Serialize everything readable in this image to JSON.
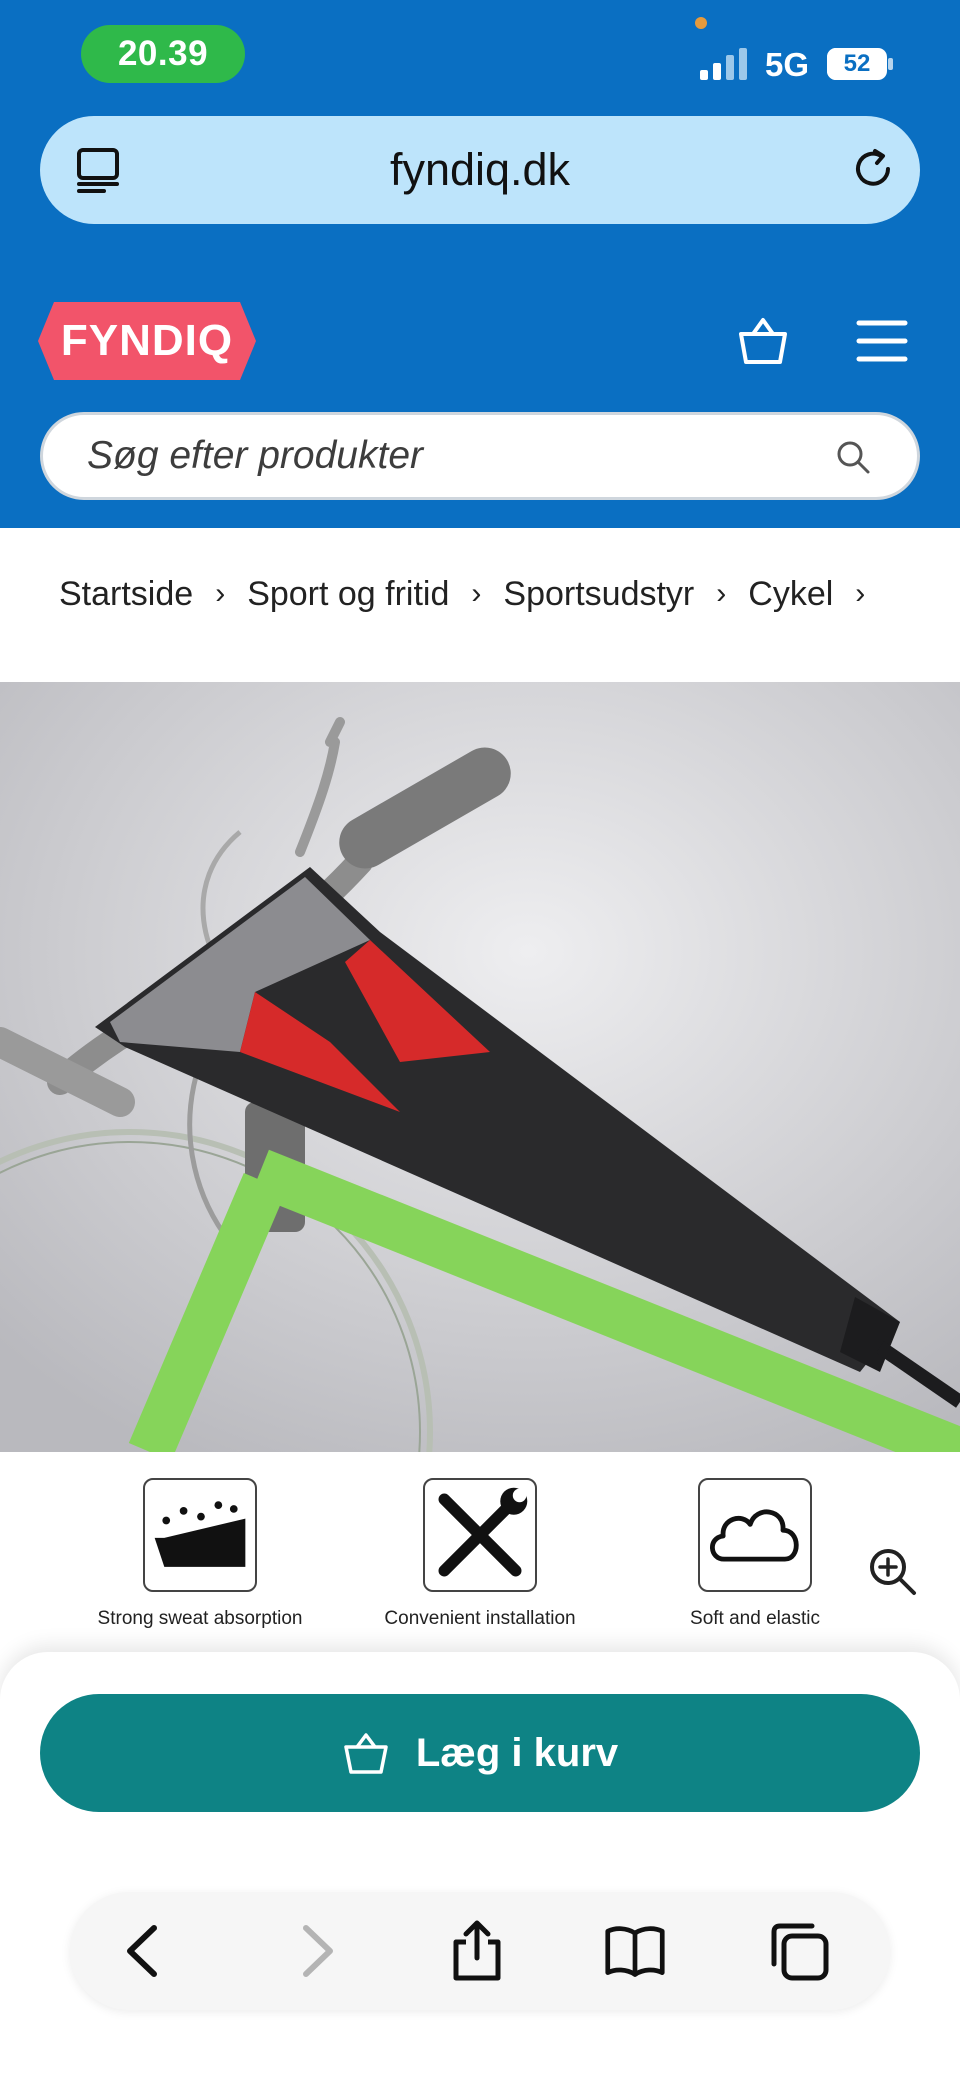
{
  "status_bar": {
    "time": "20.39",
    "network": "5G",
    "battery": "52"
  },
  "browser": {
    "url": "fyndiq.dk"
  },
  "site": {
    "logo": "FYNDIQ",
    "search_placeholder": "Søg efter produkter"
  },
  "breadcrumb": [
    "Startside",
    "Sport og fritid",
    "Sportsudstyr",
    "Cykel"
  ],
  "product": {
    "features": [
      "Strong sweat absorption",
      "Convenient installation",
      "Soft and elastic"
    ]
  },
  "actions": {
    "add_to_cart": "Læg i kurv"
  },
  "colors": {
    "header_blue": "#0a6fc2",
    "url_bar": "#bde4fb",
    "logo_pink": "#f2546a",
    "time_pill": "#2fb94a",
    "cart_button": "#0e8385"
  }
}
